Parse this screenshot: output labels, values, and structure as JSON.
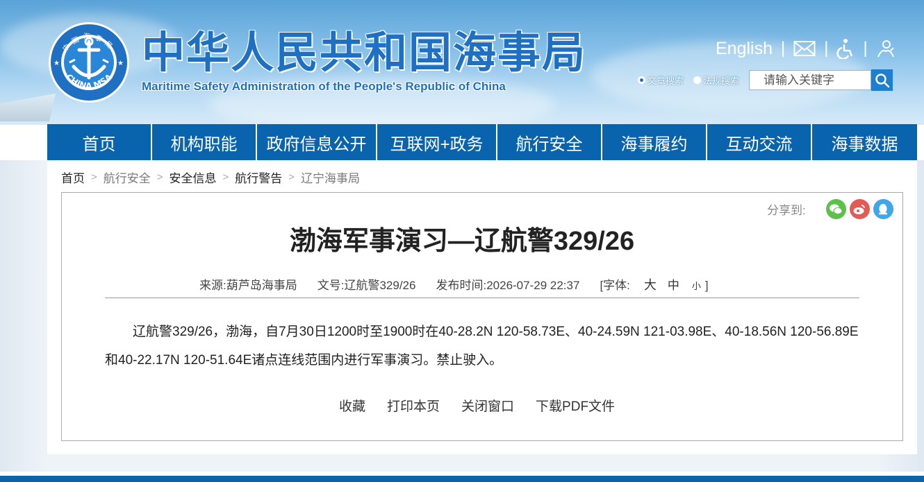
{
  "header": {
    "title_cn": "中华人民共和国海事局",
    "title_en": "Maritime Safety Administration of the People's Republic of China",
    "emblem_text": "CHINA MSA",
    "emblem_top_text": "中国海事局",
    "english_link": "English",
    "icons": [
      "mail-icon",
      "accessibility-icon",
      "user-care-icon"
    ],
    "search": {
      "option1": "文章搜索",
      "option2": "法规搜索",
      "selected": "文章搜索",
      "placeholder": "请输入关键字"
    }
  },
  "nav": {
    "items": [
      "首页",
      "机构职能",
      "政府信息公开",
      "互联网+政务",
      "航行安全",
      "海事履约",
      "互动交流",
      "海事数据"
    ]
  },
  "breadcrumb": [
    "首页",
    "航行安全",
    "安全信息",
    "航行警告",
    "辽宁海事局"
  ],
  "share": {
    "label": "分享到:",
    "icons": [
      "wechat-icon",
      "weibo-icon",
      "qq-icon"
    ]
  },
  "article": {
    "title": "渤海军事演习—辽航警329/26",
    "source_label": "来源:",
    "source": "葫芦岛海事局",
    "doc_label": "文号:",
    "doc_no": "辽航警329/26",
    "time_label": "发布时间:",
    "time": "2026-07-29 22:37",
    "font_label": "[字体:",
    "font_large": "大",
    "font_medium": "中",
    "font_small": "小",
    "font_close": "]",
    "body": "辽航警329/26，渤海，自7月30日1200时至1900时在40-28.2N 120-58.73E、40-24.59N 121-03.98E、40-18.56N 120-56.89E和40-22.17N 120-51.64E诸点连线范围内进行军事演习。禁止驶入。"
  },
  "actions": [
    "收藏",
    "打印本页",
    "关闭窗口",
    "下载PDF文件"
  ],
  "colors": {
    "brand": "#0a63ad",
    "title_blue": "#1f6fc2",
    "wechat": "#5cc04b",
    "weibo": "#e45a55",
    "qq": "#3fa6e8"
  }
}
